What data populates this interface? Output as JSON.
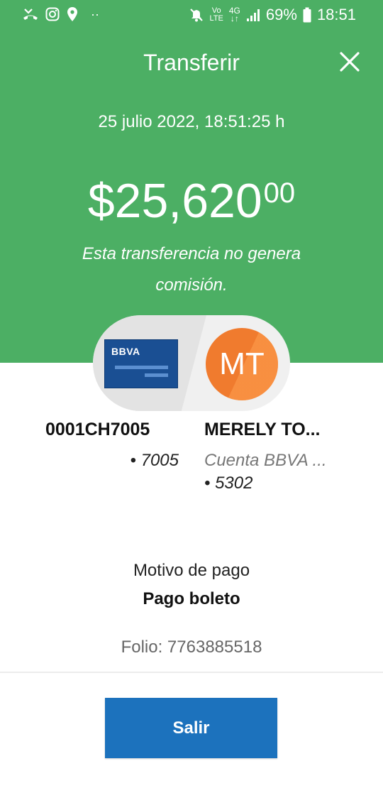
{
  "status_bar": {
    "dots": "··",
    "volte_top": "Vo",
    "volte_bottom": "LTE",
    "network": "4G",
    "battery": "69%",
    "time": "18:51"
  },
  "header": {
    "title": "Transferir",
    "date": "25 julio 2022, 18:51:25 h",
    "amount_main": "$25,620",
    "amount_cents": "00",
    "note": "Esta transferencia no genera comisión."
  },
  "origin": {
    "card_brand": "BBVA",
    "account": "0001CH7005",
    "last_digits": "• 7005"
  },
  "destination": {
    "initials": "MT",
    "name": "MERELY TO...",
    "account_type": "Cuenta BBVA ...",
    "last_digits": "• 5302"
  },
  "details": {
    "motivo_label": "Motivo de pago",
    "motivo_value": "Pago boleto",
    "folio": "Folio: 7763885518"
  },
  "actions": {
    "exit_label": "Salir"
  },
  "colors": {
    "header_green": "#4caf64",
    "button_blue": "#1c72bd",
    "avatar_orange": "#f07b2e",
    "card_blue": "#1a4f93"
  }
}
